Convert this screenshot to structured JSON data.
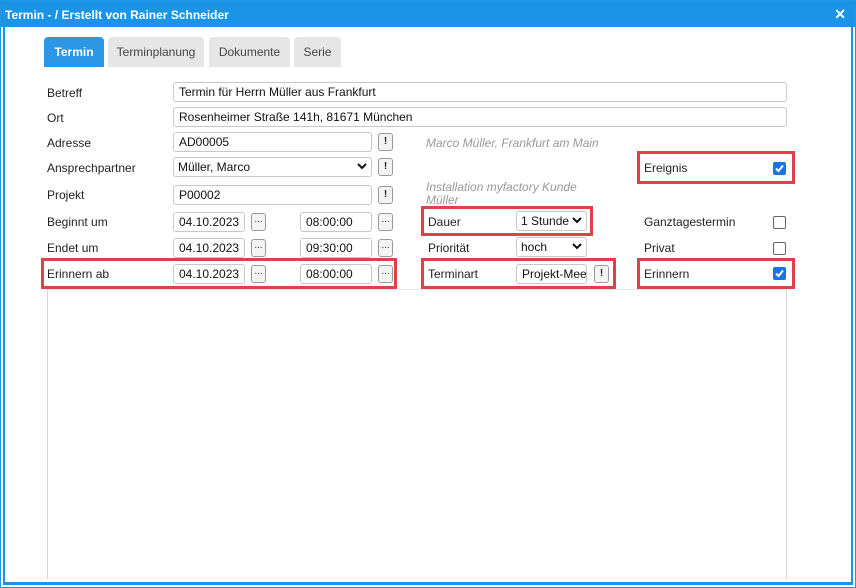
{
  "window": {
    "title": "Termin - / Erstellt von Rainer Schneider",
    "close_icon": "close-icon"
  },
  "tabs": [
    {
      "label": "Termin",
      "active": true
    },
    {
      "label": "Terminplanung",
      "active": false
    },
    {
      "label": "Dokumente",
      "active": false
    },
    {
      "label": "Serie",
      "active": false
    }
  ],
  "form": {
    "betreff": {
      "label": "Betreff",
      "value": "Termin für Herrn Müller aus Frankfurt"
    },
    "ort": {
      "label": "Ort",
      "value": "Rosenheimer Straße 141h, 81671 München"
    },
    "adresse": {
      "label": "Adresse",
      "value": "AD00005",
      "button": "!",
      "hint": "Marco Müller, Frankfurt am Main"
    },
    "ansprechpartner": {
      "label": "Ansprechpartner",
      "value": "Müller, Marco",
      "button": "!"
    },
    "projekt": {
      "label": "Projekt",
      "value": "P00002",
      "button": "!",
      "hint": "Installation myfactory Kunde Müller"
    },
    "beginnt": {
      "label": "Beginnt um",
      "date": "04.10.2023",
      "time": "08:00:00",
      "dots": "..."
    },
    "endet": {
      "label": "Endet um",
      "date": "04.10.2023",
      "time": "09:30:00",
      "dots": "..."
    },
    "erinnern_ab": {
      "label": "Erinnern ab",
      "date": "04.10.2023",
      "time": "08:00:00",
      "dots": "..."
    },
    "dauer": {
      "label": "Dauer",
      "value": "1 Stunde"
    },
    "prioritaet": {
      "label": "Priorität",
      "value": "hoch"
    },
    "terminart": {
      "label": "Terminart",
      "value": "Projekt-Meeting",
      "button": "!"
    },
    "ereignis": {
      "label": "Ereignis",
      "checked": true
    },
    "ganztagestermin": {
      "label": "Ganztagestermin",
      "checked": false
    },
    "privat": {
      "label": "Privat",
      "checked": false
    },
    "erinnern": {
      "label": "Erinnern",
      "checked": true
    }
  },
  "colors": {
    "accent": "#1a95e5",
    "highlight": "#e0404a",
    "checkbox": "#1a73e8"
  }
}
